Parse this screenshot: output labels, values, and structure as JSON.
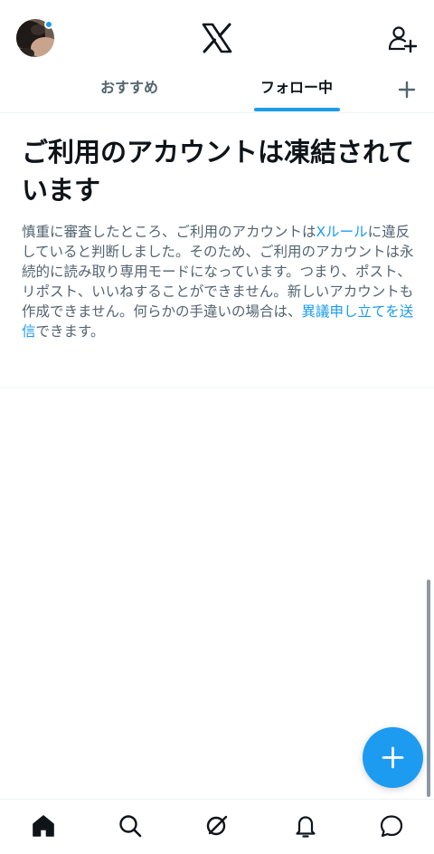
{
  "header": {
    "logo_icon": "x-logo-icon",
    "add_user_icon": "add-user-icon",
    "avatar_notification_color": "#1d9bf0"
  },
  "tabs": [
    {
      "label": "おすすめ",
      "active": false
    },
    {
      "label": "フォロー中",
      "active": true
    }
  ],
  "tab_add_icon": "plus-icon",
  "notice": {
    "headline": "ご利用のアカウントは凍結されています",
    "body_1": "慎重に審査したところ、ご利用のアカウントは",
    "rules_link": "Xルール",
    "body_2": "に違反していると判断しました。そのため、ご利用のアカウントは永続的に読み取り専用モードになっています。つまり、ポスト、リポスト、いいねすることができません。新しいアカウントも作成できません。何らかの手違いの場合は、",
    "appeal_link": "異議申し立てを送信",
    "body_3": "できます。"
  },
  "fab": {
    "icon": "plus-icon",
    "color": "#1d9bf0"
  },
  "bottom_nav": [
    {
      "name": "home",
      "icon": "home-icon"
    },
    {
      "name": "search",
      "icon": "search-icon"
    },
    {
      "name": "grok",
      "icon": "grok-icon"
    },
    {
      "name": "notifications",
      "icon": "bell-icon"
    },
    {
      "name": "messages",
      "icon": "message-icon"
    }
  ],
  "colors": {
    "accent": "#1d9bf0",
    "text_primary": "#0f1419",
    "text_secondary": "#536471",
    "divider": "#eff3f4"
  }
}
